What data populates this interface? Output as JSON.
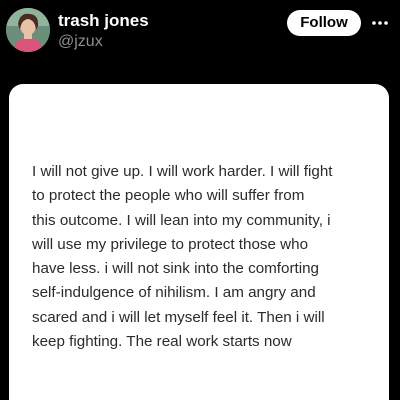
{
  "profile": {
    "display_name": "trash jones",
    "handle": "@jzux",
    "avatar_icon": "avatar-photo"
  },
  "actions": {
    "follow_label": "Follow",
    "more_icon": "more-horizontal-icon"
  },
  "post": {
    "lines": [
      "I will not give up. I will work harder. I will fight",
      "to protect the people who will suffer from",
      "this outcome. I will lean into my community, i",
      "will use my privilege to protect those who",
      "have less. i will not sink into the comforting",
      "self-indulgence of nihilism. I am angry and",
      "scared and i will let myself feel it. Then i will",
      "keep fighting. The real work starts now"
    ]
  },
  "colors": {
    "background": "#000000",
    "card": "#ffffff",
    "text_primary": "#ffffff",
    "text_secondary": "#8e8e93",
    "post_text": "#2b2b2b"
  }
}
